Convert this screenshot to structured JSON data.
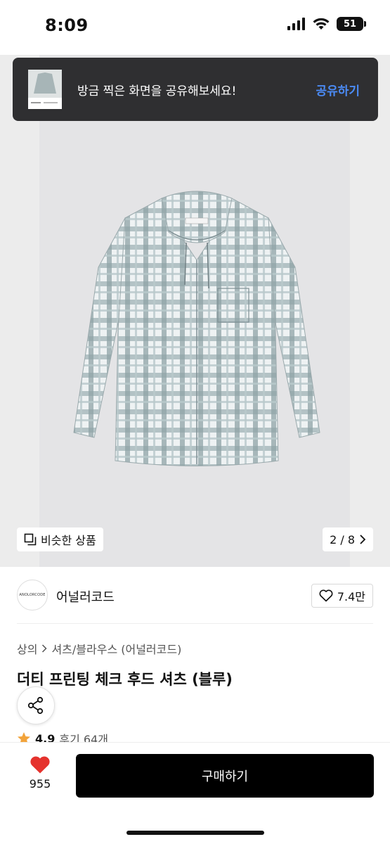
{
  "status_bar": {
    "time": "8:09",
    "battery": "51"
  },
  "toast": {
    "message": "방금 찍은 화면을 공유해보세요!",
    "action": "공유하기"
  },
  "gallery": {
    "similar_label": "비슷한 상품",
    "page_counter": "2 / 8"
  },
  "brand": {
    "logo_text": "ANOLORCODE",
    "name": "어널러코드",
    "likes": "7.4만"
  },
  "product": {
    "breadcrumb": [
      "상의",
      "셔츠/블라우스 (어널러코드)"
    ],
    "title": "더티 프린팅 체크 후드 셔츠 (블루)",
    "rating": "4.9",
    "reviews": "후기 64개"
  },
  "bottom_bar": {
    "like_count": "955",
    "buy_label": "구매하기"
  },
  "colors": {
    "accent_blue": "#4b8bf5",
    "heart_red": "#e5322d",
    "star_orange": "#f2a33a"
  }
}
